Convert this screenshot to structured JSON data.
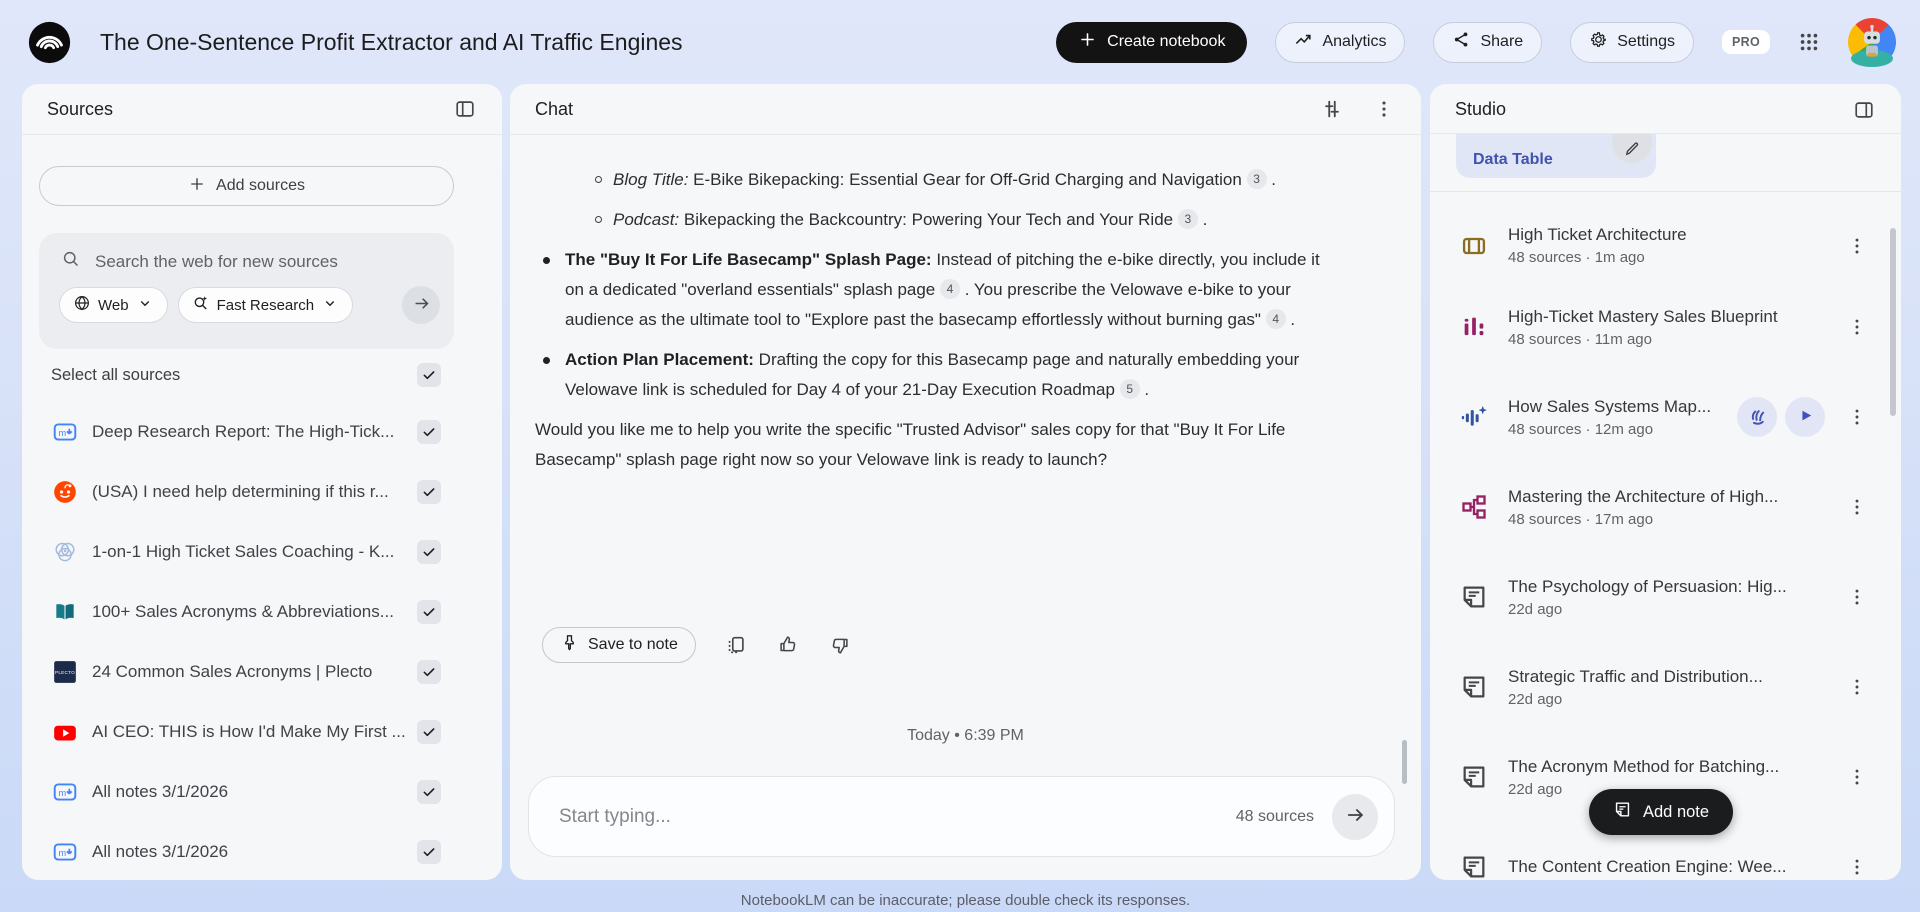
{
  "header": {
    "title": "The One-Sentence Profit Extractor and AI Traffic Engines",
    "create_notebook": "Create notebook",
    "analytics": "Analytics",
    "share": "Share",
    "settings": "Settings",
    "pro_badge": "PRO"
  },
  "colors": {
    "accent_black": "#131314",
    "panel_bg": "#f6f7f9",
    "chip_blue": "#4053ad",
    "studio_gold": "#8a6d1e",
    "studio_magenta": "#962063",
    "studio_indigo": "#33549f",
    "reddit_orange": "#ff4500",
    "youtube_red": "#ff0000",
    "note_blue": "#4285f4"
  },
  "sources": {
    "panel_title": "Sources",
    "add_sources_label": "Add sources",
    "search_placeholder": "Search the web for new sources",
    "web_filter_label": "Web",
    "research_mode_label": "Fast Research",
    "select_all_label": "Select all sources",
    "items": [
      {
        "icon": "note",
        "title": "Deep Research Report: The High-Tick...",
        "checked": true
      },
      {
        "icon": "reddit",
        "title": "(USA) I need help determining if this r...",
        "checked": true
      },
      {
        "icon": "venn",
        "title": "1-on-1 High Ticket Sales Coaching - K...",
        "checked": true
      },
      {
        "icon": "book",
        "title": "100+ Sales Acronyms & Abbreviations...",
        "checked": true
      },
      {
        "icon": "plecto",
        "title": "24 Common Sales Acronyms | Plecto",
        "checked": true
      },
      {
        "icon": "youtube",
        "title": "AI CEO: THIS is How I'd Make My First ...",
        "checked": true
      },
      {
        "icon": "note",
        "title": "All notes 3/1/2026",
        "checked": true
      },
      {
        "icon": "note",
        "title": "All notes 3/1/2026",
        "checked": true
      }
    ]
  },
  "chat": {
    "panel_title": "Chat",
    "blocks": [
      {
        "type": "sub",
        "segments": [
          {
            "s": "i",
            "t": "Blog Title:"
          },
          {
            "s": "n",
            "t": " E-Bike Bikepacking: Essential Gear for Off-Grid Charging and Navigation "
          },
          {
            "s": "c",
            "t": "3"
          },
          {
            "s": "n",
            "t": " ."
          }
        ]
      },
      {
        "type": "sub",
        "segments": [
          {
            "s": "i",
            "t": "Podcast:"
          },
          {
            "s": "n",
            "t": " Bikepacking the Backcountry: Powering Your Tech and Your Ride "
          },
          {
            "s": "c",
            "t": "3"
          },
          {
            "s": "n",
            "t": " ."
          }
        ]
      },
      {
        "type": "bullet",
        "segments": [
          {
            "s": "b",
            "t": "The \"Buy It For Life Basecamp\" Splash Page:"
          },
          {
            "s": "n",
            "t": " Instead of pitching the e-bike directly, you include it on a dedicated \"overland essentials\" splash page "
          },
          {
            "s": "c",
            "t": "4"
          },
          {
            "s": "n",
            "t": " . You prescribe the Velowave e-bike to your audience as the ultimate tool to \"Explore past the basecamp effortlessly without burning gas\" "
          },
          {
            "s": "c",
            "t": "4"
          },
          {
            "s": "n",
            "t": " ."
          }
        ]
      },
      {
        "type": "bullet",
        "segments": [
          {
            "s": "b",
            "t": "Action Plan Placement:"
          },
          {
            "s": "n",
            "t": " Drafting the copy for this Basecamp page and naturally embedding your Velowave link is scheduled for Day 4 of your 21-Day Execution Roadmap "
          },
          {
            "s": "c",
            "t": "5"
          },
          {
            "s": "n",
            "t": " ."
          }
        ]
      },
      {
        "type": "paragraph",
        "segments": [
          {
            "s": "n",
            "t": "Would you like me to help you write the specific \"Trusted Advisor\" sales copy for that \"Buy It For Life Basecamp\" splash page right now so your Velowave link is ready to launch?"
          }
        ]
      }
    ],
    "save_to_note_label": "Save to note",
    "timestamp": "Today • 6:39 PM",
    "input_placeholder": "Start typing...",
    "source_count": "48 sources",
    "disclaimer": "NotebookLM can be inaccurate; please double check its responses."
  },
  "studio": {
    "panel_title": "Studio",
    "chip_label": "Data Table",
    "add_note_label": "Add note",
    "items": [
      {
        "icon": "flashcards",
        "color": "#8a6d1e",
        "title": "High Ticket Architecture",
        "meta": "48 sources · 1m ago"
      },
      {
        "icon": "barchart",
        "color": "#962063",
        "title": "High-Ticket Mastery Sales Blueprint",
        "meta": "48 sources · 11m ago"
      },
      {
        "icon": "audio",
        "color": "#33549f",
        "title": "How Sales Systems Map...",
        "meta": "48 sources · 12m ago",
        "actions": [
          "interactive",
          "play"
        ]
      },
      {
        "icon": "mindmap",
        "color": "#962063",
        "title": "Mastering the Architecture of High...",
        "meta": "48 sources · 17m ago"
      },
      {
        "icon": "doc",
        "color": "#444746",
        "title": "The Psychology of Persuasion: Hig...",
        "meta": "22d ago"
      },
      {
        "icon": "doc",
        "color": "#444746",
        "title": "Strategic Traffic and Distribution...",
        "meta": "22d ago"
      },
      {
        "icon": "doc",
        "color": "#444746",
        "title": "The Acronym Method for Batching...",
        "meta": "22d ago"
      },
      {
        "icon": "doc",
        "color": "#444746",
        "title": "The Content Creation Engine: Wee...",
        "meta": ""
      }
    ]
  }
}
